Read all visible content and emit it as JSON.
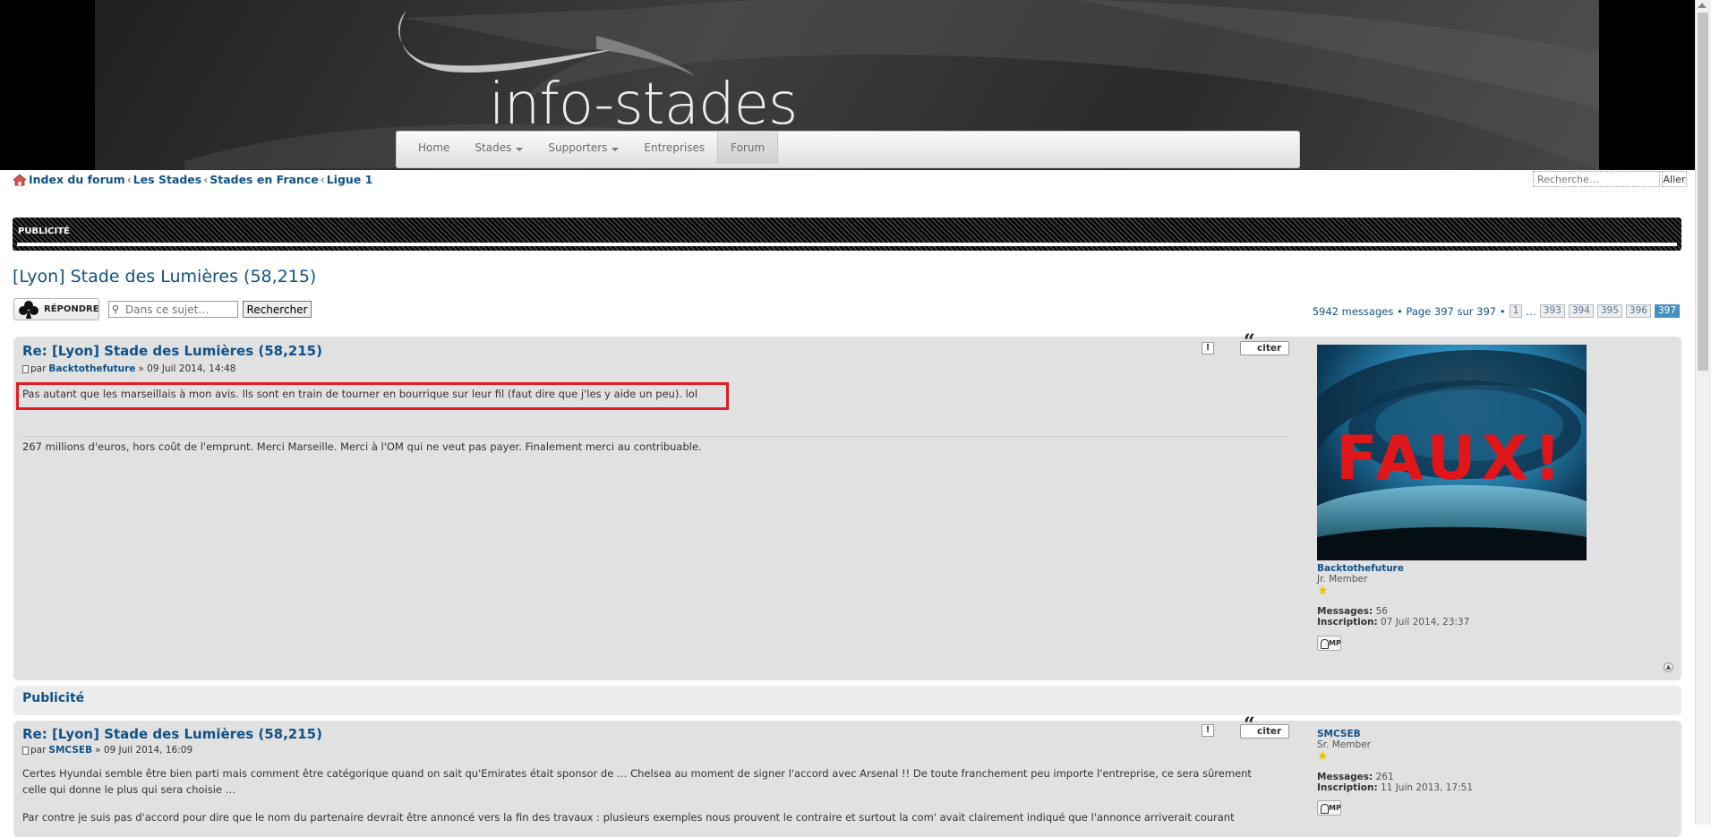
{
  "site": {
    "logo_text": "info-stades"
  },
  "nav": {
    "items": [
      {
        "label": "Home",
        "dropdown": false,
        "active": false
      },
      {
        "label": "Stades",
        "dropdown": true,
        "active": false
      },
      {
        "label": "Supporters",
        "dropdown": true,
        "active": false
      },
      {
        "label": "Entreprises",
        "dropdown": false,
        "active": false
      },
      {
        "label": "Forum",
        "dropdown": false,
        "active": true
      }
    ]
  },
  "breadcrumb": {
    "icon": "home-icon",
    "items": [
      "Index du forum",
      "Les Stades",
      "Stades en France",
      "Ligue 1"
    ],
    "separator": "‹"
  },
  "search": {
    "placeholder": "Recherche…",
    "button": "Aller"
  },
  "ad_banner": {
    "label": "PUBLICITÉ"
  },
  "topic": {
    "title": "[Lyon] Stade des Lumières (58,215)",
    "reply_button": "RÉPONDRE",
    "search_placeholder": "Dans ce sujet…",
    "search_button": "Rechercher",
    "pagination": {
      "summary": "5942 messages • Page 397 sur 397 •",
      "pages": [
        "1",
        "…",
        "393",
        "394",
        "395",
        "396",
        "397"
      ],
      "current": "397"
    }
  },
  "posts": [
    {
      "title": "Re: [Lyon] Stade des Lumières (58,215)",
      "by": "par",
      "author": "Backtothefuture",
      "date": "» 09 Juil 2014, 14:48",
      "body": "Pas autant que les marseillais à mon avis.  Ils sont en train de tourner en bourrique sur leur fil (faut dire que j'les y aide un peu). lol",
      "signature": "267 millions d'euros, hors coût de l'emprunt. Merci Marseille. Merci à l'OM qui ne veut pas payer. Finalement merci au contribuable.",
      "report": "!",
      "quote": "citer",
      "avatar_text": "FAUX!",
      "profile": {
        "name": "Backtothefuture",
        "rank": "Jr. Member",
        "messages_label": "Messages:",
        "messages": "56",
        "joined_label": "Inscription:",
        "joined": "07 Juil 2014, 23:37",
        "pm": "MP"
      }
    },
    {
      "title": "Re: [Lyon] Stade des Lumières (58,215)",
      "by": "par",
      "author": "SMCSEB",
      "date": "» 09 Juil 2014, 16:09",
      "body_1": "Certes Hyundai semble être bien parti mais comment être catégorique quand on sait qu'Emirates était sponsor de … Chelsea au moment de signer l'accord avec Arsenal !! De toute franchement peu importe l'entreprise, ce sera sûrement",
      "body_2": "celle qui donne le plus qui sera choisie …",
      "body_3": "Par contre je suis pas d'accord pour dire que le nom du partenaire devrait être annoncé vers la fin des travaux : plusieurs exemples nous prouvent le contraire et surtout la com' avait clairement indiqué que l'annonce arriverait courant",
      "report": "!",
      "quote": "citer",
      "profile": {
        "name": "SMCSEB",
        "rank": "Sr. Member",
        "messages_label": "Messages:",
        "messages": "261",
        "joined_label": "Inscription:",
        "joined": "11 Juin 2013, 17:51",
        "pm": "MP"
      }
    }
  ],
  "ad_panel": {
    "label": "Publicité"
  },
  "colors": {
    "link": "#105289",
    "highlight": "#e11b22",
    "post_bg": "#e1e1e1"
  }
}
